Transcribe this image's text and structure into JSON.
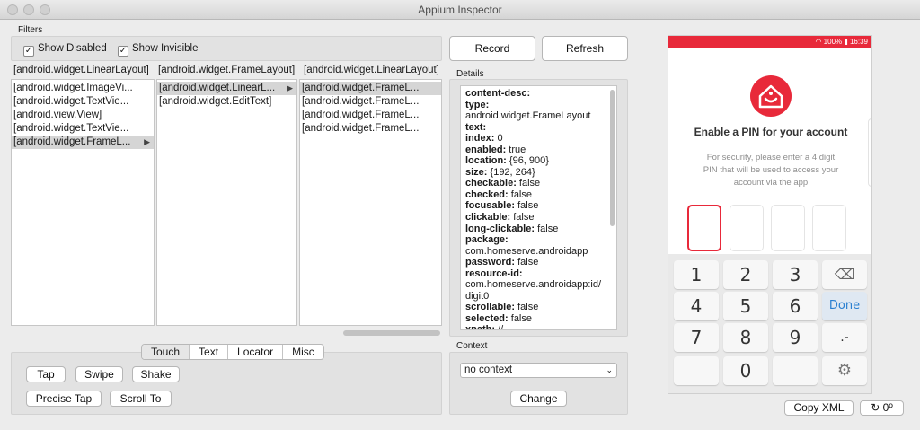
{
  "window": {
    "title": "Appium Inspector"
  },
  "filters": {
    "title": "Filters",
    "show_disabled": "Show Disabled",
    "show_invisible": "Show Invisible"
  },
  "columns": [
    {
      "header": "[android.widget.LinearLayout]",
      "items": [
        "[android.widget.ImageVi...",
        "[android.widget.TextVie...",
        "[android.view.View]",
        "[android.widget.TextVie...",
        "[android.widget.FrameL..."
      ]
    },
    {
      "header": "[android.widget.FrameLayout]",
      "items": [
        "[android.widget.LinearL...",
        "[android.widget.EditText]"
      ]
    },
    {
      "header": "[android.widget.LinearLayout]",
      "items": [
        "[android.widget.FrameL...",
        "[android.widget.FrameL...",
        "[android.widget.FrameL...",
        "[android.widget.FrameL..."
      ]
    }
  ],
  "buttons": {
    "record": "Record",
    "refresh": "Refresh",
    "change": "Change",
    "copy_xml": "Copy XML",
    "rotate": "0º"
  },
  "details": {
    "title": "Details",
    "lines": [
      {
        "k": "content-desc:",
        "v": ""
      },
      {
        "k": "type:",
        "v": ""
      },
      {
        "k": "",
        "v": "android.widget.FrameLayout"
      },
      {
        "k": "text:",
        "v": ""
      },
      {
        "k": "index:",
        "v": " 0"
      },
      {
        "k": "enabled:",
        "v": " true"
      },
      {
        "k": "location:",
        "v": " {96, 900}"
      },
      {
        "k": "size:",
        "v": " {192, 264}"
      },
      {
        "k": "checkable:",
        "v": " false"
      },
      {
        "k": "checked:",
        "v": " false"
      },
      {
        "k": "focusable:",
        "v": " false"
      },
      {
        "k": "clickable:",
        "v": " false"
      },
      {
        "k": "long-clickable:",
        "v": " false"
      },
      {
        "k": "package:",
        "v": ""
      },
      {
        "k": "",
        "v": "com.homeserve.androidapp"
      },
      {
        "k": "password:",
        "v": " false"
      },
      {
        "k": "resource-id:",
        "v": ""
      },
      {
        "k": "",
        "v": "com.homeserve.androidapp:id/"
      },
      {
        "k": "",
        "v": "digit0"
      },
      {
        "k": "scrollable:",
        "v": " false"
      },
      {
        "k": "selected:",
        "v": " false"
      },
      {
        "k": "xpath:",
        "v": " //"
      }
    ]
  },
  "actions": {
    "tabs": [
      "Touch",
      "Text",
      "Locator",
      "Misc"
    ],
    "active_tab": "Touch",
    "tap": "Tap",
    "swipe": "Swipe",
    "shake": "Shake",
    "precise_tap": "Precise Tap",
    "scroll_to": "Scroll To"
  },
  "context": {
    "title": "Context",
    "value": "no context"
  },
  "phone": {
    "status": "100% ▮ 16:39",
    "heading": "Enable a PIN for your account",
    "description": [
      "For security, please enter a 4 digit",
      "PIN that will be used to access your",
      "account via the app"
    ],
    "keys": [
      "1",
      "2",
      "3",
      "⌫",
      "4",
      "5",
      "6",
      "Done",
      "7",
      "8",
      "9",
      ".-",
      "",
      "0",
      "",
      ""
    ],
    "colors": {
      "accent": "#e8293a",
      "done": "#2a7fd0"
    }
  }
}
